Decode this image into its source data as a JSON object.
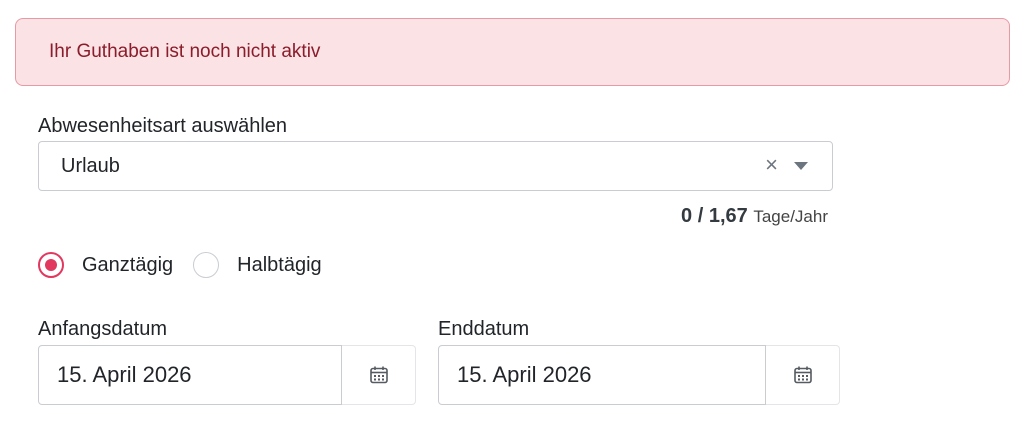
{
  "alert": {
    "message": "Ihr Guthaben ist noch nicht aktiv"
  },
  "absence_type": {
    "label": "Abwesenheitsart auswählen",
    "selected": "Urlaub",
    "clear_symbol": "×"
  },
  "quota": {
    "value": "0 / 1,67",
    "unit": "Tage/Jahr"
  },
  "day_type": {
    "options": [
      {
        "label": "Ganztägig",
        "checked": true
      },
      {
        "label": "Halbtägig",
        "checked": false
      }
    ]
  },
  "start_date": {
    "label": "Anfangsdatum",
    "value": "15. April 2026",
    "icon": "calendar-icon"
  },
  "end_date": {
    "label": "Enddatum",
    "value": "15. April 2026",
    "icon": "calendar-icon"
  },
  "colors": {
    "accent": "#e2385f",
    "alert_bg": "#fbe2e5",
    "alert_text": "#8b1c2b"
  }
}
